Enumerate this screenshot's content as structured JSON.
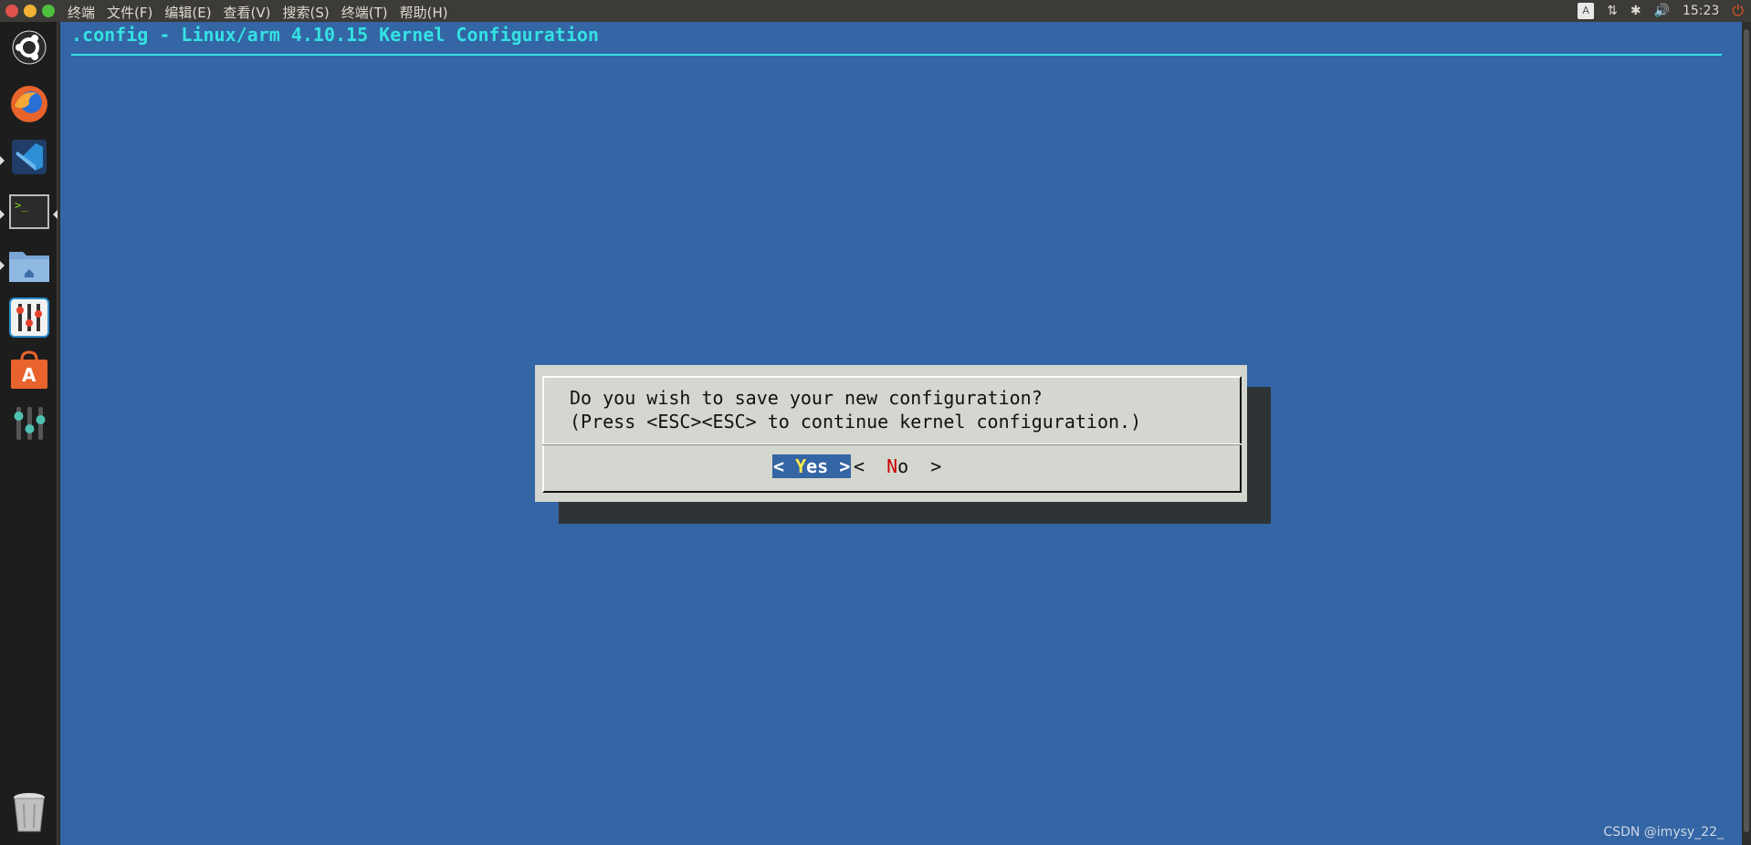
{
  "menubar": {
    "items": [
      "终端",
      "文件(F)",
      "编辑(E)",
      "查看(V)",
      "搜索(S)",
      "终端(T)",
      "帮助(H)"
    ]
  },
  "tray": {
    "keyboard_label": "A",
    "network_icon": "network-updown-icon",
    "bluetooth_icon": "bluetooth-icon",
    "volume_icon": "volume-icon",
    "clock": "15:23",
    "power_icon": "power-icon"
  },
  "launcher": {
    "items": [
      "ubuntu-logo",
      "firefox",
      "vscode",
      "terminal",
      "files",
      "system-settings",
      "software-center",
      "unity-tweak",
      "trash"
    ]
  },
  "terminal": {
    "title": ".config - Linux/arm 4.10.15 Kernel Configuration",
    "dialog": {
      "line1": "Do you wish to save your new configuration?",
      "line2": "(Press <ESC><ESC> to continue kernel configuration.)",
      "yes_prefix": "< ",
      "yes_hot": "Y",
      "yes_rest": "es >",
      "no_prefix": "<  ",
      "no_hot": "N",
      "no_rest": "o  >"
    }
  },
  "watermark": "CSDN @imysy_22_",
  "colors": {
    "terminal_bg": "#3465a4",
    "title": "#34e2e2",
    "dialog_bg": "#d3d7cf",
    "hotkey_yes": "#fce94f",
    "hotkey_no": "#cc0000"
  }
}
